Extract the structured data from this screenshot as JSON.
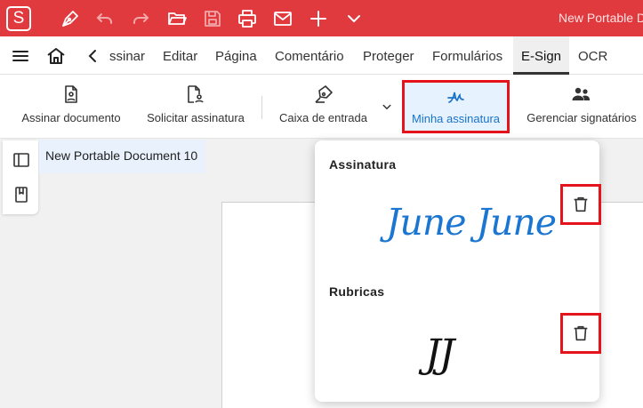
{
  "titlebar": {
    "logo": "S",
    "document_title": "New Portable D",
    "icons": [
      "pen-icon",
      "undo-icon",
      "redo-icon",
      "folder-open-icon",
      "save-icon",
      "print-icon",
      "mail-icon",
      "plus-icon",
      "chevron-down-icon"
    ]
  },
  "menubar": {
    "items": {
      "assinar": "ssinar",
      "editar": "Editar",
      "pagina": "Página",
      "comentario": "Comentário",
      "proteger": "Proteger",
      "formularios": "Formulários",
      "esign": "E-Sign",
      "ocr": "OCR"
    },
    "active": "E-Sign"
  },
  "toolbar": {
    "assinar_documento": "Assinar documento",
    "solicitar_assinatura": "Solicitar assinatura",
    "caixa_de_entrada": "Caixa de entrada",
    "minha_assinatura": "Minha assinatura",
    "gerenciar_signatarios": "Gerenciar signatários"
  },
  "doc_tab": {
    "label": "New Portable Document 10"
  },
  "popup": {
    "assinatura_title": "Assinatura",
    "assinatura_signature": "June June",
    "rubricas_title": "Rubricas",
    "rubricas_signature": "JJ"
  },
  "colors": {
    "brand_red": "#e0393e",
    "accent_blue": "#1b76d2",
    "highlight_red": "#e5141c"
  }
}
